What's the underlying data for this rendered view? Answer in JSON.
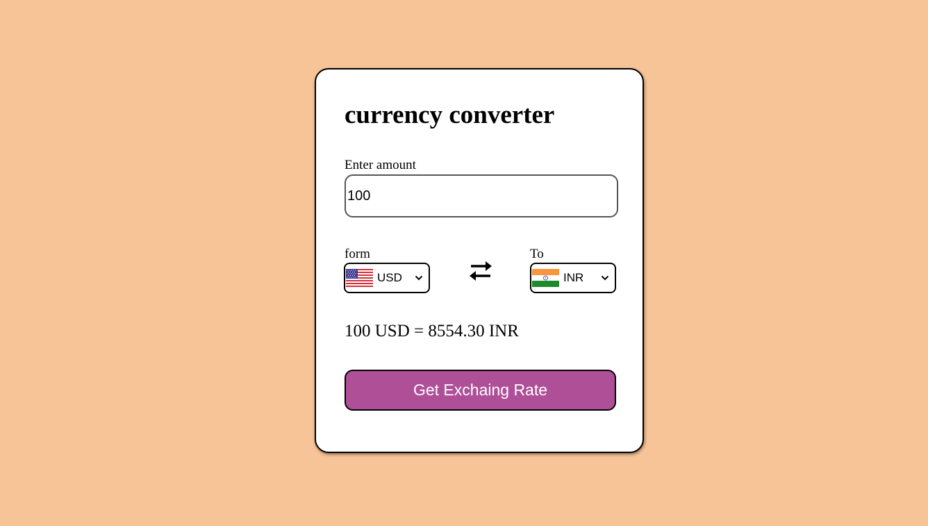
{
  "app": {
    "title": "currency converter"
  },
  "amount": {
    "label": "Enter amount",
    "value": "100"
  },
  "from": {
    "label": "form",
    "currency": "USD",
    "flag_icon": "us-flag-icon"
  },
  "to": {
    "label": "To",
    "currency": "INR",
    "flag_icon": "india-flag-icon"
  },
  "swap_icon": "swap-arrows-icon",
  "result": {
    "text": "100 USD = 8554.30 INR"
  },
  "button": {
    "label": "Get Exchaing Rate"
  },
  "colors": {
    "background": "#f7c497",
    "card": "#ffffff",
    "button": "#af4f98",
    "button_text": "#ffffff"
  }
}
